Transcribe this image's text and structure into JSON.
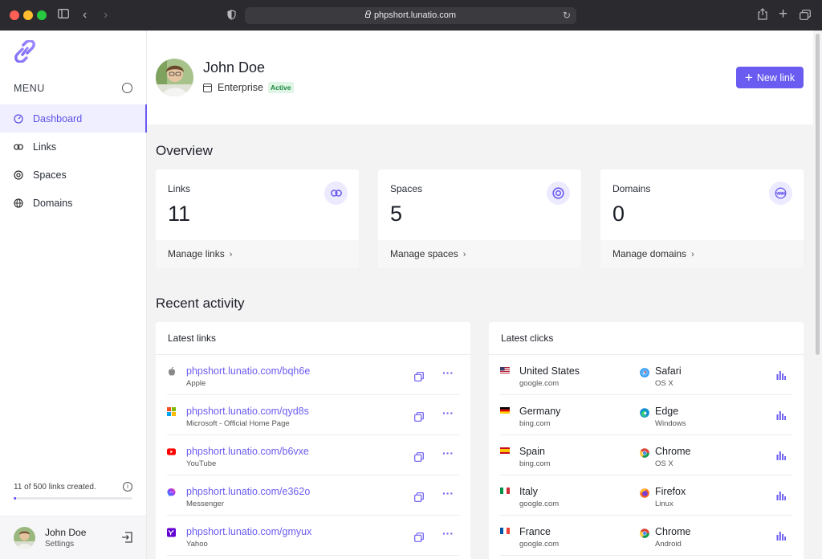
{
  "browser": {
    "url": "phpshort.lunatio.com"
  },
  "sidebar": {
    "menu_label": "MENU",
    "items": [
      {
        "label": "Dashboard",
        "active": true
      },
      {
        "label": "Links",
        "active": false
      },
      {
        "label": "Spaces",
        "active": false
      },
      {
        "label": "Domains",
        "active": false
      }
    ],
    "usage_text": "11 of 500 links created.",
    "usage_fraction": 0.022,
    "user_name": "John Doe",
    "user_sub": "Settings"
  },
  "header": {
    "name": "John Doe",
    "plan": "Enterprise",
    "plan_status": "Active",
    "new_link_label": "New link"
  },
  "overview": {
    "title": "Overview",
    "cards": [
      {
        "label": "Links",
        "value": "11",
        "link": "Manage links"
      },
      {
        "label": "Spaces",
        "value": "5",
        "link": "Manage spaces"
      },
      {
        "label": "Domains",
        "value": "0",
        "link": "Manage domains"
      }
    ]
  },
  "recent": {
    "title": "Recent activity",
    "links_title": "Latest links",
    "clicks_title": "Latest clicks",
    "links": [
      {
        "url": "phpshort.lunatio.com/bqh6e",
        "title": "Apple",
        "icon": "apple-icon"
      },
      {
        "url": "phpshort.lunatio.com/qyd8s",
        "title": "Microsoft - Official Home Page",
        "icon": "microsoft-icon"
      },
      {
        "url": "phpshort.lunatio.com/b6vxe",
        "title": "YouTube",
        "icon": "youtube-icon"
      },
      {
        "url": "phpshort.lunatio.com/e362o",
        "title": "Messenger",
        "icon": "messenger-icon"
      },
      {
        "url": "phpshort.lunatio.com/gmyux",
        "title": "Yahoo",
        "icon": "yahoo-icon"
      }
    ],
    "clicks": [
      {
        "country": "United States",
        "referrer": "google.com",
        "browser": "Safari",
        "os": "OS X"
      },
      {
        "country": "Germany",
        "referrer": "bing.com",
        "browser": "Edge",
        "os": "Windows"
      },
      {
        "country": "Spain",
        "referrer": "bing.com",
        "browser": "Chrome",
        "os": "OS X"
      },
      {
        "country": "Italy",
        "referrer": "google.com",
        "browser": "Firefox",
        "os": "Linux"
      },
      {
        "country": "France",
        "referrer": "google.com",
        "browser": "Chrome",
        "os": "Android"
      }
    ]
  },
  "colors": {
    "accent": "#6a5cf0",
    "active_bg": "#f0efff",
    "badge_green": "#1d8a3f"
  }
}
